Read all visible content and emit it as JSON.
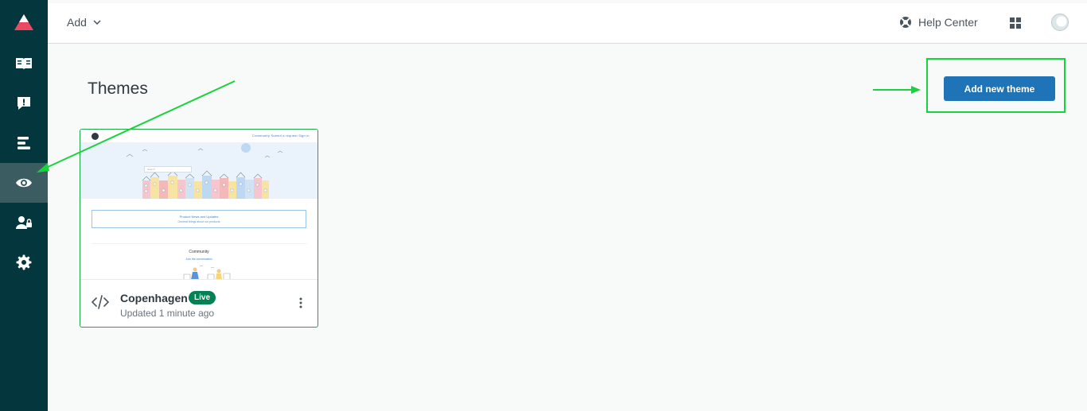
{
  "sidebar": {
    "items": [
      {
        "name": "guide-icon"
      },
      {
        "name": "feedback-icon"
      },
      {
        "name": "arrange-content-icon"
      },
      {
        "name": "customize-design-icon",
        "active": true
      },
      {
        "name": "user-permissions-icon"
      },
      {
        "name": "settings-icon"
      }
    ],
    "colors": {
      "background": "#03363d",
      "active": "#3b5d62",
      "logo_accent": "#eb4962"
    }
  },
  "topbar": {
    "add_label": "Add",
    "help_center_label": "Help Center"
  },
  "main": {
    "title": "Themes",
    "add_theme_label": "Add new theme"
  },
  "theme": {
    "name": "Copenhagen",
    "badge": "Live",
    "updated": "Updated 1 minute ago",
    "preview": {
      "nav_links": "Community    Submit a request    Sign in",
      "search_placeholder": "Search",
      "section_title": "Product News and Updates",
      "section_subtitle": "General things about our products",
      "community_title": "Community",
      "community_subtitle": "Join the conversation"
    }
  },
  "colors": {
    "primary_button": "#1f73b7",
    "live_badge": "#038153",
    "annotation": "#19d33d"
  }
}
